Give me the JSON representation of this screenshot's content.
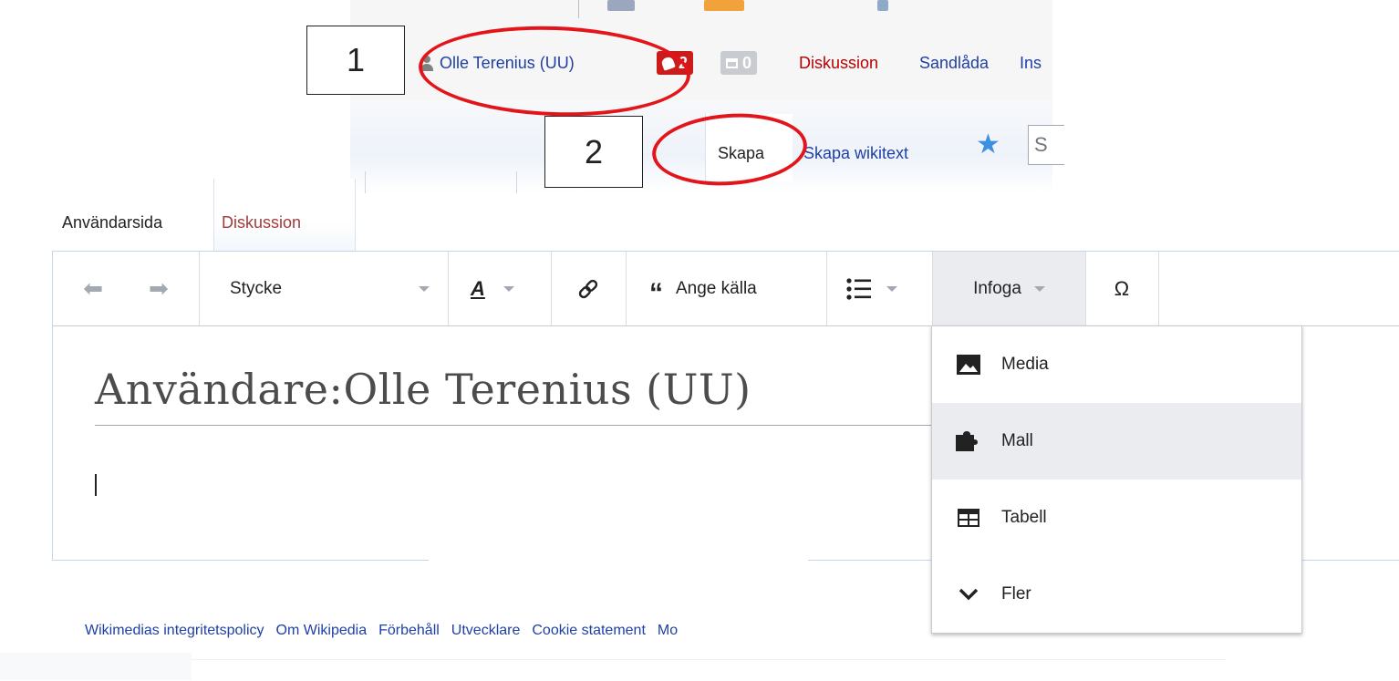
{
  "personal_tools": {
    "username": "Olle Terenius (UU)",
    "alerts_count": "2",
    "notices_count": "0",
    "discussion": "Diskussion",
    "sandbox": "Sandlåda",
    "settings_partial": "Ins"
  },
  "view_tabs": {
    "create": "Skapa",
    "create_wikitext": "Skapa wikitext",
    "search_partial": "S"
  },
  "annotations": {
    "box1": "1",
    "box2": "2"
  },
  "page_tabs": {
    "user_page": "Användarsida",
    "discussion": "Diskussion"
  },
  "toolbar": {
    "format": "Stycke",
    "cite": "Ange källa",
    "insert": "Infoga"
  },
  "content": {
    "heading": "Användare:Olle Terenius (UU)"
  },
  "insert_menu": {
    "items": [
      {
        "label": "Media",
        "icon": "image-icon"
      },
      {
        "label": "Mall",
        "icon": "puzzle-icon"
      },
      {
        "label": "Tabell",
        "icon": "table-icon"
      },
      {
        "label": "Fler",
        "icon": "chevron-down-icon"
      }
    ]
  },
  "footer": {
    "links": [
      "Wikimedias integritetspolicy",
      "Om Wikipedia",
      "Förbehåll",
      "Utvecklare",
      "Cookie statement",
      "Mo"
    ]
  },
  "colors": {
    "link": "#1f3fa6",
    "redlink": "#ba0000",
    "annotation": "#e3151a",
    "alert_badge": "#cc1b1b"
  }
}
